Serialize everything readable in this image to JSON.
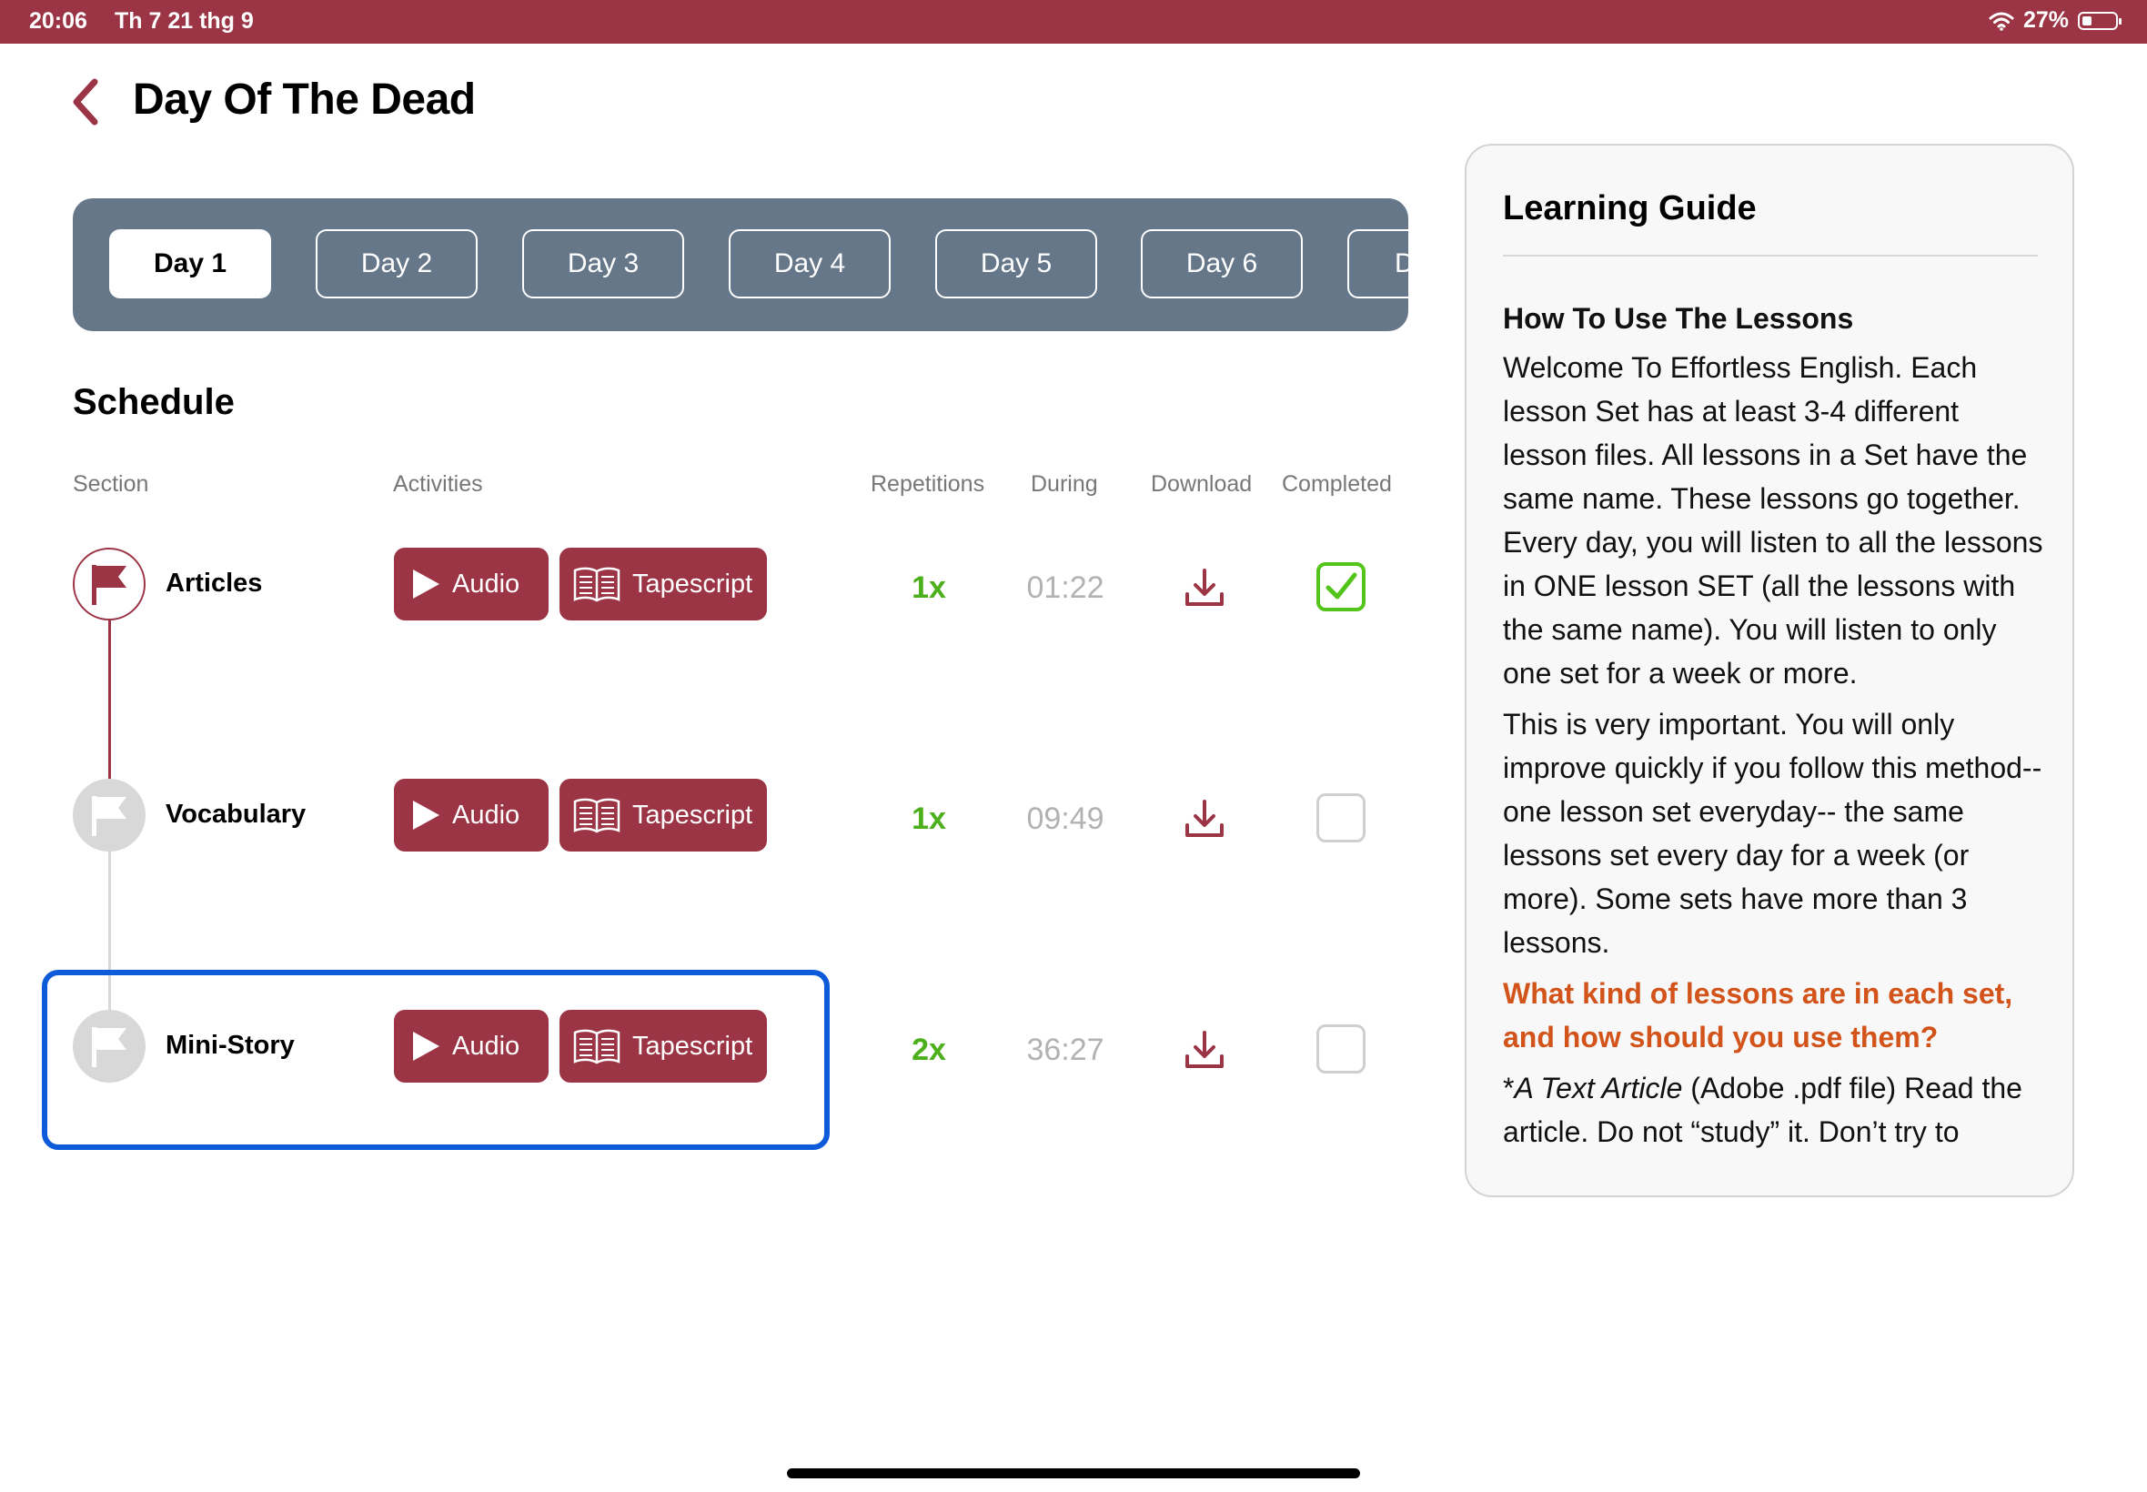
{
  "status": {
    "time": "20:06",
    "date": "Th 7 21 thg 9",
    "battery": "27%"
  },
  "header": {
    "title": "Day Of The Dead"
  },
  "days": [
    "Day 1",
    "Day 2",
    "Day 3",
    "Day 4",
    "Day 5",
    "Day 6",
    "D"
  ],
  "schedule": {
    "title": "Schedule",
    "columns": {
      "section": "Section",
      "activities": "Activities",
      "repetitions": "Repetitions",
      "during": "During",
      "download": "Download",
      "completed": "Completed"
    },
    "rows": [
      {
        "section": "Articles",
        "audio": "Audio",
        "tapescript": "Tapescript",
        "reps": "1x",
        "during": "01:22",
        "completed": true
      },
      {
        "section": "Vocabulary",
        "audio": "Audio",
        "tapescript": "Tapescript",
        "reps": "1x",
        "during": "09:49",
        "completed": false
      },
      {
        "section": "Mini-Story",
        "audio": "Audio",
        "tapescript": "Tapescript",
        "reps": "2x",
        "during": "36:27",
        "completed": false
      }
    ]
  },
  "guide": {
    "title": "Learning Guide",
    "subtitle": "How To Use The Lessons",
    "p1": "Welcome To Effortless English. Each lesson Set has at least 3-4 different lesson files. All lessons in a Set have the same name. These lessons go together. Every day, you will listen to all the lessons in ONE lesson SET (all the lessons with the same name). You will listen to only one set for a week or more.",
    "p2": "This is very important. You will only improve quickly if you follow this method-- one lesson set everyday-- the same lessons set every day for a week (or more). Some sets have more than 3 lessons.",
    "question": "What kind of lessons are in each set, and how should you use them?",
    "p3_prefix": "*",
    "p3_italic": "A Text Article",
    "p3_rest": " (Adobe .pdf file) Read the article. Do not “study” it. Don’t try to"
  },
  "colors": {
    "brand": "#9b3445",
    "daybar": "#66778a",
    "green": "#4caf1c",
    "highlight": "#0d5bd9",
    "orange": "#d3541b"
  }
}
